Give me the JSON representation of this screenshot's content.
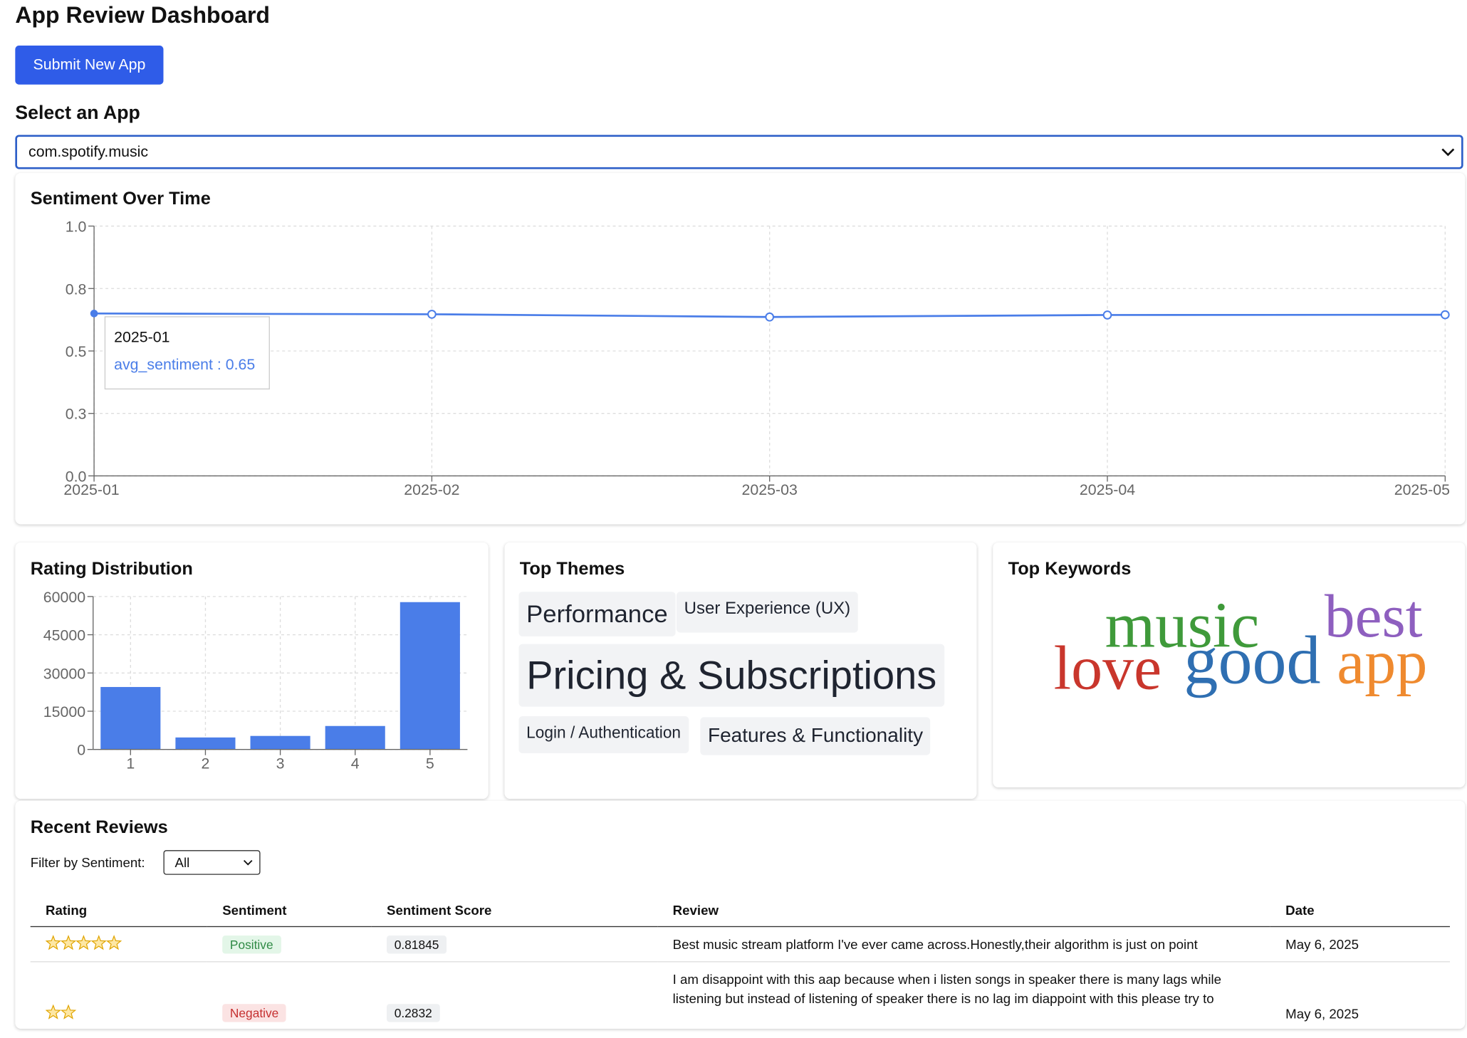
{
  "page_title": "App Review Dashboard",
  "submit_button": "Submit New App",
  "select_heading": "Select an App",
  "selected_app": "com.spotify.music",
  "sentiment_chart": {
    "title": "Sentiment Over Time",
    "tooltip": {
      "label": "2025-01",
      "value_text": "avg_sentiment : 0.65"
    }
  },
  "rating_chart": {
    "title": "Rating Distribution"
  },
  "themes": {
    "title": "Top Themes",
    "items": [
      "Performance",
      "User Experience (UX)",
      "Pricing & Subscriptions",
      "Login / Authentication",
      "Features & Functionality"
    ]
  },
  "keywords": {
    "title": "Top Keywords",
    "items": [
      {
        "word": "music",
        "color": "#3f9a3a"
      },
      {
        "word": "best",
        "color": "#8e5fbf"
      },
      {
        "word": "love",
        "color": "#c9362c"
      },
      {
        "word": "good",
        "color": "#2f6fb2"
      },
      {
        "word": "app",
        "color": "#ef8a2f"
      }
    ]
  },
  "reviews": {
    "title": "Recent Reviews",
    "filter_label": "Filter by Sentiment:",
    "filter_value": "All",
    "columns": [
      "Rating",
      "Sentiment",
      "Sentiment Score",
      "Review",
      "Date"
    ],
    "rows": [
      {
        "rating": 5,
        "sentiment": "Positive",
        "score": "0.81845",
        "review": "Best music stream platform I've ever came across.Honestly,their algorithm is just on point",
        "date": "May 6, 2025"
      },
      {
        "rating": 2,
        "sentiment": "Negative",
        "score": "0.2832",
        "review": "I am disappoint with this aap because when i listen songs in speaker there is many lags while listening but instead of listening of speaker there is no lag im diappoint with this please try to",
        "date": "May 6, 2025"
      }
    ]
  },
  "colors": {
    "accent": "#2f5ce8",
    "chart_blue": "#4a7de8",
    "positive_bg": "#e3f6e8",
    "positive_fg": "#2f8a45",
    "negative_bg": "#fbe3e3",
    "negative_fg": "#c53030"
  },
  "chart_data": [
    {
      "type": "line",
      "title": "Sentiment Over Time",
      "x": [
        "2025-01",
        "2025-02",
        "2025-03",
        "2025-04",
        "2025-05"
      ],
      "series": [
        {
          "name": "avg_sentiment",
          "values": [
            0.65,
            0.647,
            0.636,
            0.644,
            0.645
          ]
        }
      ],
      "ylim": [
        0,
        1.0
      ],
      "yticks": [
        "0.0",
        "0.3",
        "0.5",
        "0.8",
        "1.0"
      ],
      "ytick_values": [
        0,
        0.25,
        0.5,
        0.75,
        1.0
      ],
      "grid": true
    },
    {
      "type": "bar",
      "title": "Rating Distribution",
      "categories": [
        "1",
        "2",
        "3",
        "4",
        "5"
      ],
      "values": [
        24500,
        4700,
        5300,
        9200,
        57800
      ],
      "ylim": [
        0,
        60000
      ],
      "yticks": [
        "0",
        "15000",
        "30000",
        "45000",
        "60000"
      ],
      "ytick_values": [
        0,
        15000,
        30000,
        45000,
        60000
      ],
      "grid": true
    }
  ]
}
